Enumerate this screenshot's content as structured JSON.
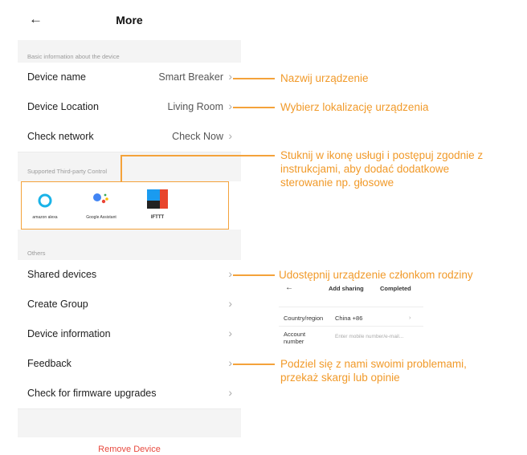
{
  "header": {
    "back_icon": "←",
    "title": "More"
  },
  "sections": {
    "basic": "Basic information about the device",
    "third_party": "Supported Third-party Control",
    "others": "Others"
  },
  "basic_rows": [
    {
      "label": "Device name",
      "value": "Smart Breaker"
    },
    {
      "label": "Device Location",
      "value": "Living Room"
    },
    {
      "label": "Check network",
      "value": "Check Now"
    }
  ],
  "third_party": [
    {
      "caption": "amazon alexa",
      "icon": "alexa-icon"
    },
    {
      "caption": "Google Assistant",
      "icon": "google-assistant-icon"
    },
    {
      "caption": "IFTTT",
      "icon": "ifttt-icon"
    }
  ],
  "other_rows": [
    {
      "label": "Shared devices"
    },
    {
      "label": "Create Group"
    },
    {
      "label": "Device information"
    },
    {
      "label": "Feedback"
    },
    {
      "label": "Check for firmware upgrades"
    }
  ],
  "remove_label": "Remove Device",
  "annotations": {
    "name": "Nazwij urządzenie",
    "location": "Wybierz lokalizację urządzenia",
    "third_party": "Stuknij w ikonę usługi i postępuj zgodnie z instrukcjami, aby dodać dodatkowe sterowanie np. głosowe",
    "share": "Udostępnij urządzenie członkom rodziny",
    "feedback": "Podziel się z nami swoimi problemami, przekaż skargi lub opinie"
  },
  "mini_share": {
    "back_icon": "←",
    "title": "Add sharing",
    "action": "Completed",
    "country_label": "Country/region",
    "country_value": "China +86",
    "account_label": "Account number",
    "account_placeholder": "Enter mobile number/e-mail..."
  },
  "colors": {
    "accent": "#f19a2a",
    "danger": "#e84a3f"
  }
}
